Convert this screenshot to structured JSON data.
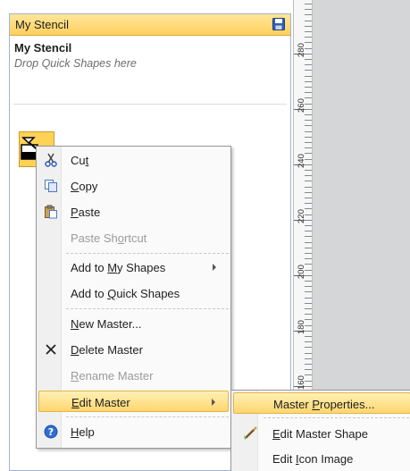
{
  "stencil": {
    "header_title": "My Stencil",
    "title": "My Stencil",
    "hint": "Drop Quick Shapes here"
  },
  "ruler": {
    "labels": [
      "280",
      "260",
      "240",
      "220",
      "200",
      "180",
      "160"
    ]
  },
  "context_menu": {
    "items": [
      {
        "pre": "Cu",
        "key": "t",
        "post": ""
      },
      {
        "pre": "",
        "key": "C",
        "post": "opy"
      },
      {
        "pre": "",
        "key": "P",
        "post": "aste"
      },
      {
        "pre": "Paste Sh",
        "key": "o",
        "post": "rtcut"
      },
      {
        "pre": "Add to ",
        "key": "M",
        "post": "y Shapes"
      },
      {
        "pre": "Add to ",
        "key": "Q",
        "post": "uick Shapes"
      },
      {
        "pre": "",
        "key": "N",
        "post": "ew Master..."
      },
      {
        "pre": "",
        "key": "D",
        "post": "elete Master"
      },
      {
        "pre": "",
        "key": "R",
        "post": "ename Master"
      },
      {
        "pre": "",
        "key": "E",
        "post": "dit Master"
      },
      {
        "pre": "",
        "key": "H",
        "post": "elp"
      }
    ]
  },
  "submenu": {
    "items": [
      {
        "pre": "Master ",
        "key": "P",
        "post": "roperties..."
      },
      {
        "pre": "",
        "key": "E",
        "post": "dit Master Shape"
      },
      {
        "pre": "Edit ",
        "key": "I",
        "post": "con Image"
      }
    ]
  },
  "colors": {
    "highlight": "#ffd66f",
    "header": "#ffcf5e",
    "canvas": "#d4d6d8"
  }
}
